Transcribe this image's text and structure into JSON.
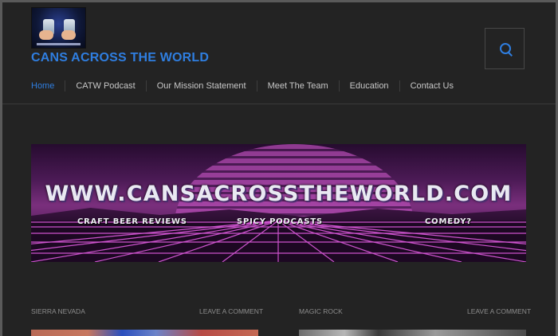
{
  "site": {
    "title": "CANS ACROSS THE WORLD",
    "logo_text": "cansacrosstheworld.com"
  },
  "search": {
    "icon": "search-icon"
  },
  "nav": {
    "items": [
      "Home",
      "CATW Podcast",
      "Our Mission Statement",
      "Meet The Team",
      "Education",
      "Contact Us"
    ]
  },
  "banner": {
    "url": "WWW.CANSACROSSTHEWORLD.COM",
    "tag1": "CRAFT BEER REVIEWS",
    "tag2": "SPICY PODCASTS",
    "tag3": "COMEDY?"
  },
  "posts": [
    {
      "category": "SIERRA NEVADA",
      "comment": "LEAVE A COMMENT"
    },
    {
      "category": "MAGIC ROCK",
      "comment": "LEAVE A COMMENT"
    }
  ],
  "colors": {
    "accent": "#2f7ee0",
    "background": "#232323"
  }
}
